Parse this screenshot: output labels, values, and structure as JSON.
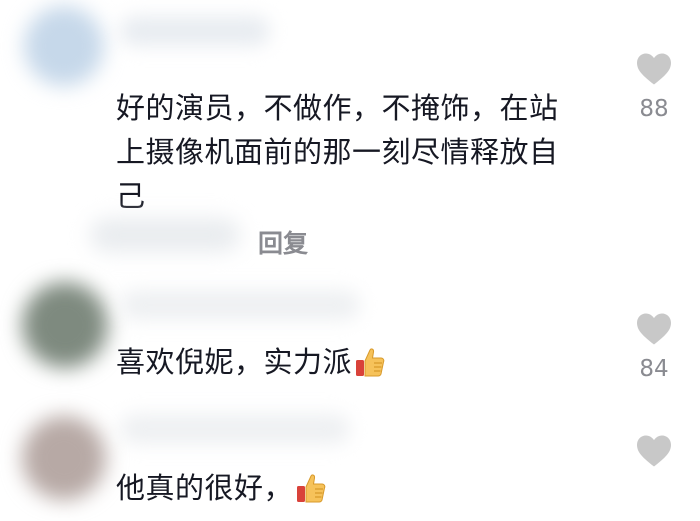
{
  "comments": [
    {
      "text": "好的演员，不做作，不掩饰，在站上摄像机面前的那一刻尽情释放自己",
      "likes": "88",
      "has_thumb": false
    },
    {
      "text": "喜欢倪妮，实力派",
      "likes": "84",
      "has_thumb": true
    },
    {
      "text": "他真的很好，",
      "likes": "",
      "has_thumb": true
    }
  ],
  "reply": {
    "label": "回复"
  },
  "icons": {
    "like": "heart-icon",
    "emoji": "thumbs-up-emoji-icon"
  },
  "colors": {
    "text": "#161823",
    "muted": "#8a8b91",
    "heart": "#c8c8c8"
  }
}
